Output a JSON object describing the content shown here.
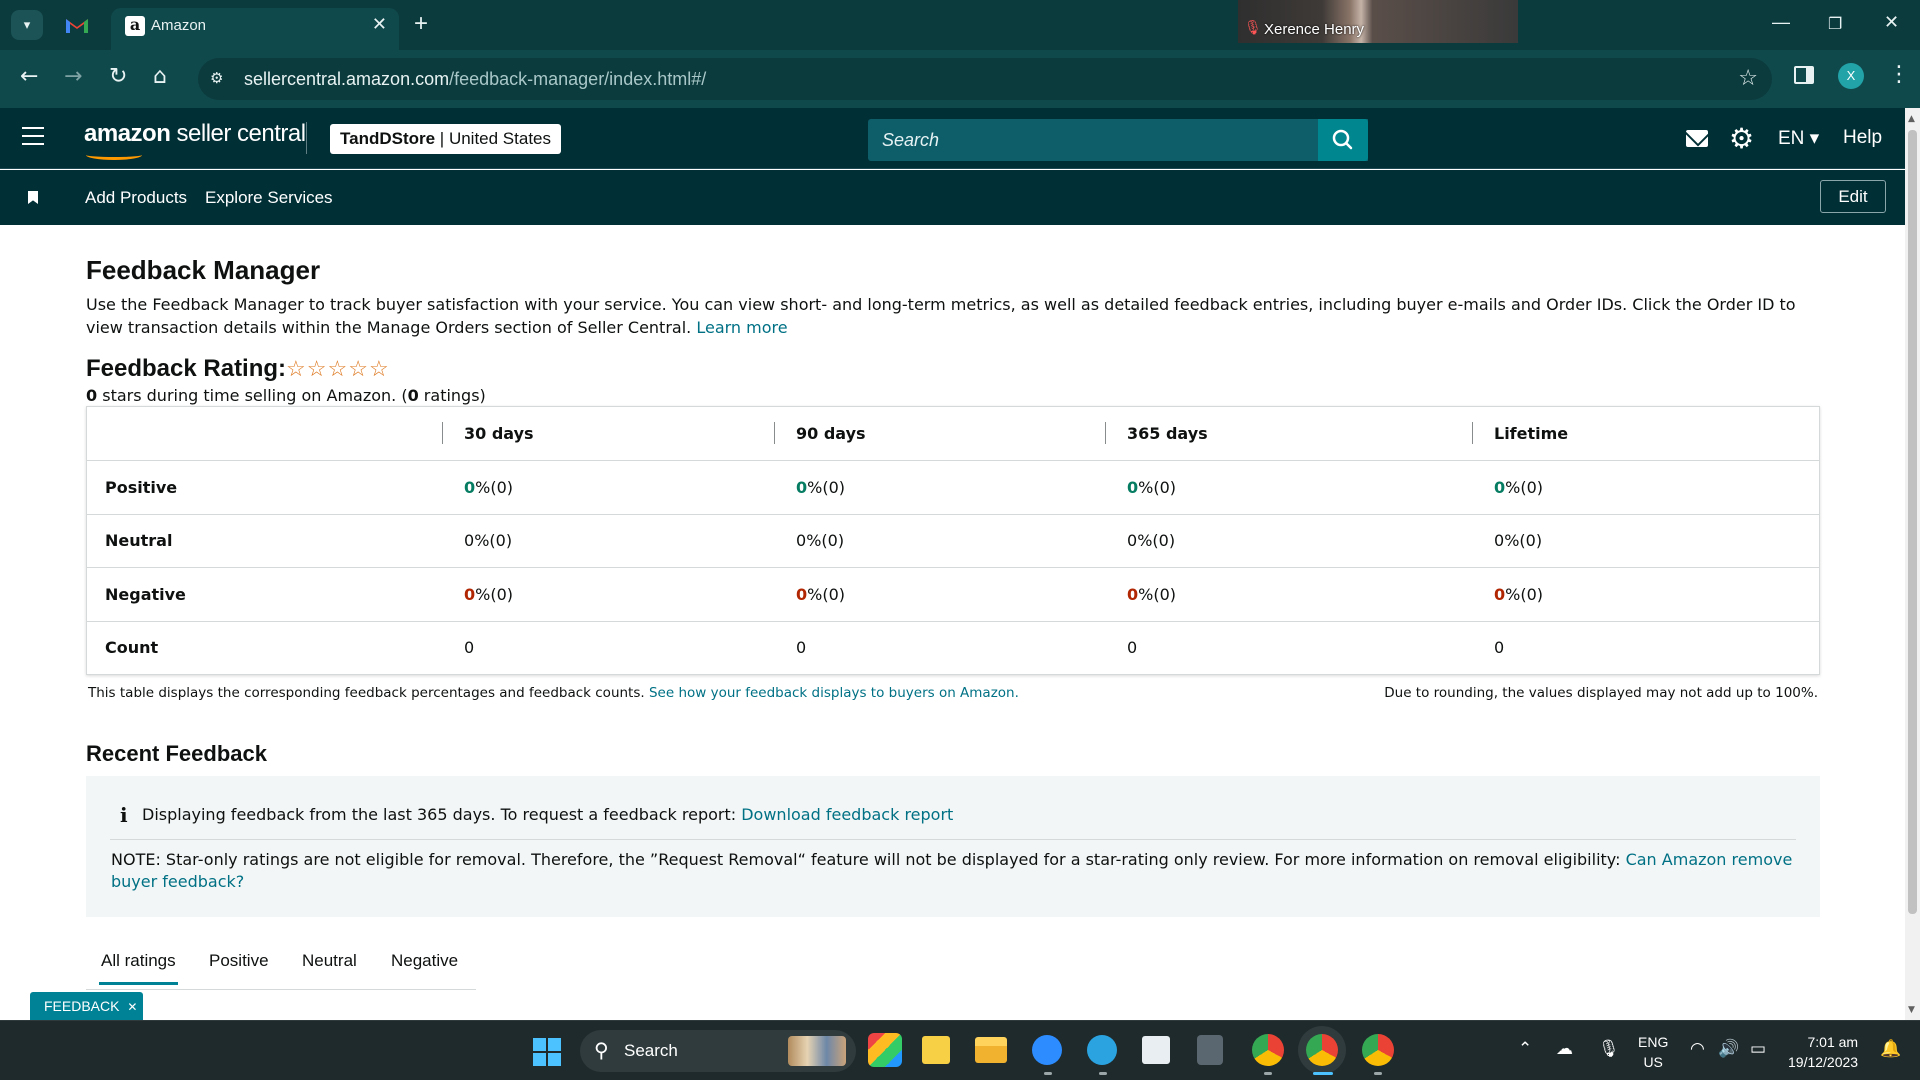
{
  "browser": {
    "tab_title": "Amazon",
    "tab_favicon": "a",
    "url_host": "sellercentral.amazon.com",
    "url_path": "/feedback-manager/index.html#/",
    "profile_initial": "X",
    "video_participant": "Xerence Henry"
  },
  "header": {
    "logo_bold": "amazon",
    "logo_rest": " seller central",
    "store_name": "TandDStore",
    "store_region": " | United States",
    "search_placeholder": "Search",
    "language": "EN",
    "help": "Help"
  },
  "subnav": {
    "links": [
      "Add Products",
      "Explore Services"
    ],
    "edit": "Edit"
  },
  "page": {
    "title": "Feedback Manager",
    "intro": "Use the Feedback Manager to track buyer satisfaction with your service. You can view short- and long-term metrics, as well as detailed feedback entries, including buyer e-mails and Order IDs. Click the Order ID to view transaction details within the Manage Orders section of Seller Central.",
    "learn_more": "Learn more",
    "rating_label": "Feedback Rating:",
    "rating_stars": "☆☆☆☆☆",
    "stars_value": "0",
    "stars_text": " stars during time selling on Amazon. (",
    "ratings_value": "0",
    "ratings_text": " ratings)"
  },
  "feedback_table": {
    "columns": [
      "30 days",
      "90 days",
      "365 days",
      "Lifetime"
    ],
    "rows": [
      {
        "label": "Positive",
        "values": [
          [
            "0",
            " %(0)"
          ],
          [
            "0",
            " %(0)"
          ],
          [
            "0",
            " %(0)"
          ],
          [
            "0",
            " %(0)"
          ]
        ]
      },
      {
        "label": "Neutral",
        "values": [
          [
            "0",
            " %(0)"
          ],
          [
            "0",
            " %(0)"
          ],
          [
            "0",
            " %(0)"
          ],
          [
            "0",
            " %(0)"
          ]
        ]
      },
      {
        "label": "Negative",
        "values": [
          [
            "0",
            " %(0)"
          ],
          [
            "0",
            " %(0)"
          ],
          [
            "0",
            " %(0)"
          ],
          [
            "0",
            " %(0)"
          ]
        ]
      },
      {
        "label": "Count",
        "values": [
          [
            "0",
            ""
          ],
          [
            "0",
            ""
          ],
          [
            "0",
            ""
          ],
          [
            "0",
            ""
          ]
        ]
      }
    ],
    "note_left": "This table displays the corresponding feedback percentages and feedback counts.",
    "note_link": "See how your feedback displays to buyers on Amazon.",
    "note_right": "Due to rounding, the values displayed may not add up to 100%."
  },
  "recent": {
    "title": "Recent Feedback",
    "info_text": "Displaying feedback from the last 365 days. To request a feedback report:",
    "download_link": "Download feedback report",
    "note_text": "NOTE: Star-only ratings are not eligible for removal. Therefore, the ”Request Removal“ feature will not be displayed for a star-rating only review. For more information on removal eligibility:",
    "note_link": "Can Amazon remove buyer feedback?",
    "tabs": [
      "All ratings",
      "Positive",
      "Neutral",
      "Negative"
    ],
    "active_tab": "All ratings"
  },
  "badge": {
    "label": "FEEDBACK",
    "close": "✕"
  },
  "taskbar": {
    "search_label": "Search",
    "lang_top": "ENG",
    "lang_bottom": "US",
    "time": "7:01 am",
    "date": "19/12/2023"
  },
  "colors": {
    "positive": "#067d62",
    "negative": "#b12704",
    "link": "#007185",
    "header_bg": "#002f36"
  }
}
